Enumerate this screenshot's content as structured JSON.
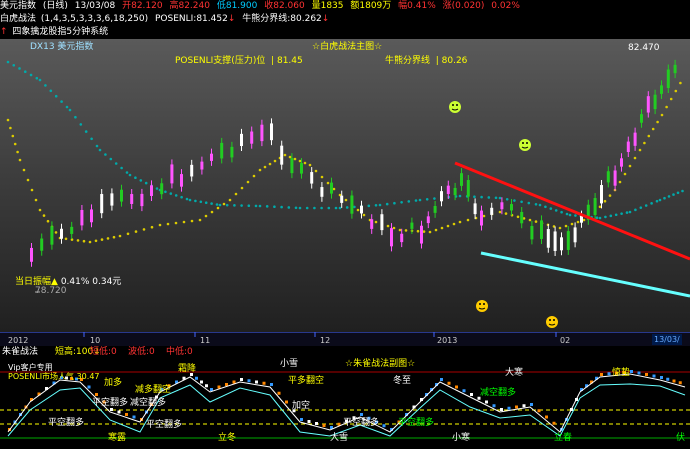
{
  "header": {
    "title": "美元指数",
    "period": "(日线)",
    "date": "13/03/08",
    "open": "开82.120",
    "high": "高82.240",
    "low": "低81.900",
    "close": "收82.060",
    "volume": "量1835",
    "amount": "额1809万",
    "change_pct": "幅0.41%",
    "change": "涨(0.020)",
    "extra": "0.02%"
  },
  "indicator1": {
    "name": "白虎战法",
    "params": "(1,4,3,5,3,3,3,6,18,250)",
    "posenli_label": "POSENLI:",
    "posenli_value": "81.452",
    "niuxiong_label": "牛熊分界线:",
    "niuxiong_value": "80.262"
  },
  "indicator2": {
    "label": "四象擒龙股指5分钟系统"
  },
  "main": {
    "corner_label": "DX13 美元指数",
    "chart_title": "☆白虎战法主图☆",
    "posenli_support_label": "POSENLI支撑(压力)位",
    "posenli_support_value": "81.45",
    "niuxiong_line_label": "牛熊分界线",
    "niuxiong_line_value": "80.26",
    "price_high": "82.470",
    "price_low": "78.720",
    "today_amp_label": "当日振幅",
    "today_amp_values": "0.41% 0.34元",
    "time_axis": [
      "2012",
      "10",
      "11",
      "12",
      "2013",
      "02",
      "13/03/"
    ]
  },
  "sub": {
    "name": "朱雀战法",
    "params": [
      {
        "label": "短高:",
        "value": "100",
        "color": "#ffff00"
      },
      {
        "label": "短低:",
        "value": "0",
        "color": "#ff3333"
      },
      {
        "label": "波低:",
        "value": "0",
        "color": "#ff3333"
      },
      {
        "label": "中低:",
        "value": "0",
        "color": "#ff3333"
      }
    ],
    "title": "☆朱雀战法副图☆",
    "left_labels": [
      "Vip客户专用",
      "POSENLI市场人气 30.47"
    ],
    "events": [
      {
        "text": "小雪",
        "color": "#ffffff"
      },
      {
        "text": "霜降",
        "color": "#ffff00"
      },
      {
        "text": "大寒",
        "color": "#ffffff"
      },
      {
        "text": "冬至",
        "color": "#ffffff"
      },
      {
        "text": "惊蛰",
        "color": "#ffff00"
      },
      {
        "text": "加多",
        "color": "#ffff00"
      },
      {
        "text": "平多翻空",
        "color": "#ffff00"
      },
      {
        "text": "减多翻空",
        "color": "#ffff00"
      },
      {
        "text": "减空翻多",
        "color": "#00ff00"
      },
      {
        "text": "平空翻多",
        "color": "#ffffff"
      },
      {
        "text": "减空翻多",
        "color": "#ffffff"
      },
      {
        "text": "加空",
        "color": "#ffffff"
      },
      {
        "text": "平空翻多",
        "color": "#ffffff"
      },
      {
        "text": "平空翻多",
        "color": "#ffffff"
      },
      {
        "text": "平空翻多",
        "color": "#ffffff"
      },
      {
        "text": "平空翻多",
        "color": "#00ff00"
      },
      {
        "text": "寒露",
        "color": "#ffff00"
      },
      {
        "text": "立冬",
        "color": "#ffff00"
      },
      {
        "text": "大雪",
        "color": "#ffffff"
      },
      {
        "text": "小寒",
        "color": "#ffffff"
      },
      {
        "text": "立春",
        "color": "#00ff00"
      },
      {
        "text": "伏",
        "color": "#00ff00"
      }
    ]
  },
  "colors": {
    "bull_candle": "#ff55ff",
    "bear_candle": "#22cc22",
    "neutral_candle": "#ffffff",
    "dotted_cyan": "#00aaaa",
    "dotted_yellow": "#ddcc00",
    "trend_red": "#ff1111",
    "trend_cyan": "#66ffff"
  }
}
